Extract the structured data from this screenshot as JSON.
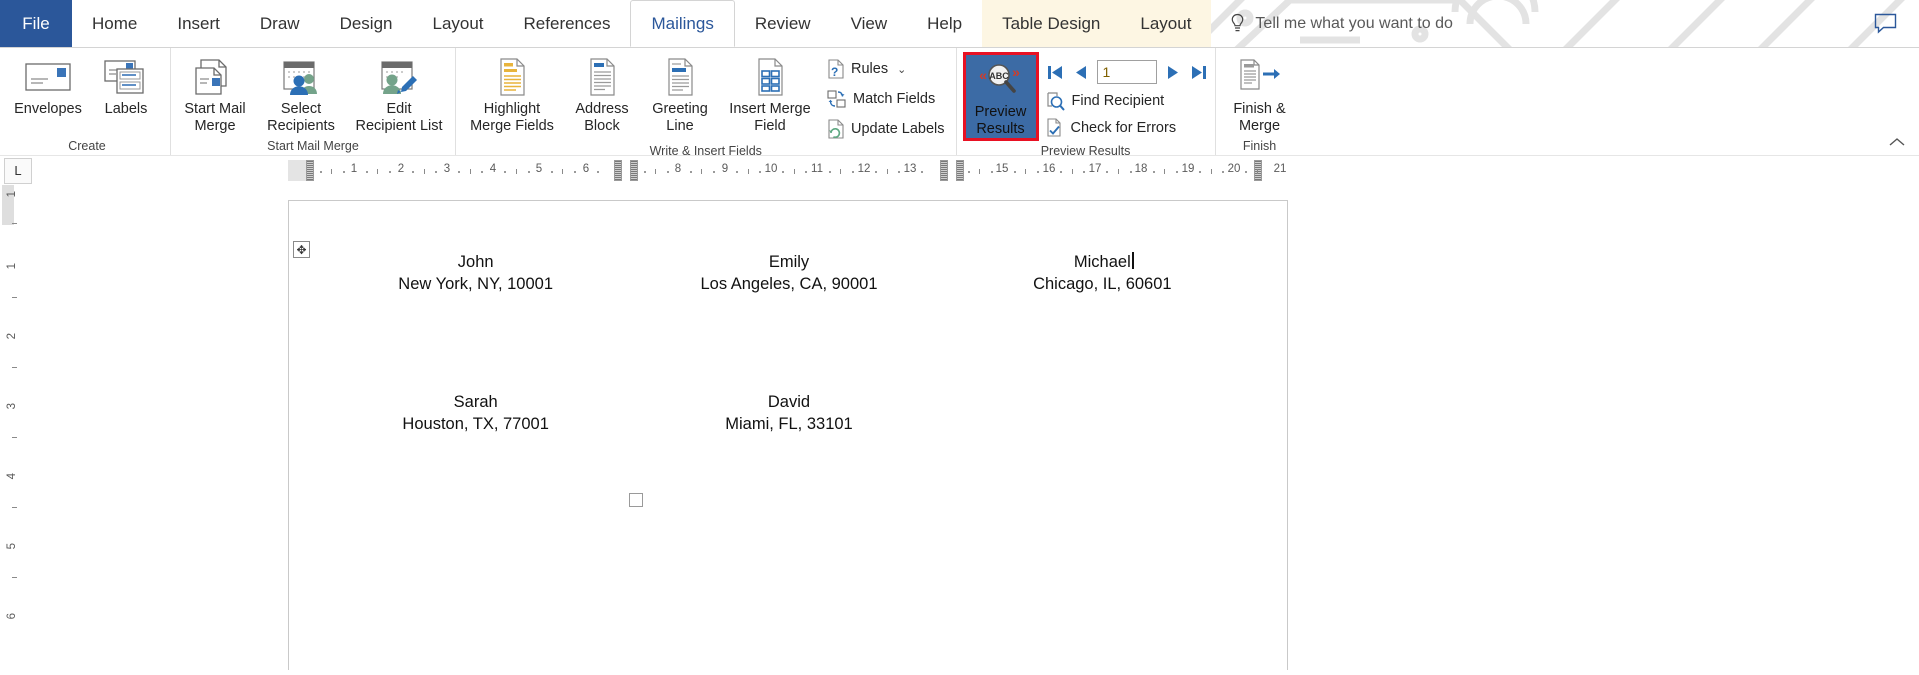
{
  "app": {
    "tabs": [
      {
        "label": "File",
        "state": "file"
      },
      {
        "label": "Home",
        "state": "normal"
      },
      {
        "label": "Insert",
        "state": "normal"
      },
      {
        "label": "Draw",
        "state": "normal"
      },
      {
        "label": "Design",
        "state": "normal"
      },
      {
        "label": "Layout",
        "state": "normal"
      },
      {
        "label": "References",
        "state": "normal"
      },
      {
        "label": "Mailings",
        "state": "active"
      },
      {
        "label": "Review",
        "state": "normal"
      },
      {
        "label": "View",
        "state": "normal"
      },
      {
        "label": "Help",
        "state": "normal"
      },
      {
        "label": "Table Design",
        "state": "contextual"
      },
      {
        "label": "Layout",
        "state": "contextual"
      }
    ],
    "tell_me": {
      "icon": "lightbulb-icon",
      "placeholder": "Tell me what you want to do"
    },
    "comment_icon": "comment-icon",
    "collapse_ribbon_icon": "chevron-up-icon",
    "colors": {
      "file_tab_blue": "#2b579a",
      "active_tab_text": "#2b579a",
      "contextual_tab_bg": "#fdf6e3",
      "highlight_red": "#e81123",
      "selected_button_bg": "#3c6ba5",
      "record_number_text": "#7f6000"
    }
  },
  "ribbon": {
    "groups": [
      {
        "label": "Create",
        "buttons": [
          {
            "label": "Envelopes",
            "icon": "envelope-icon",
            "dropdown": false
          },
          {
            "label": "Labels",
            "icon": "labels-icon",
            "dropdown": false
          }
        ]
      },
      {
        "label": "Start Mail Merge",
        "buttons": [
          {
            "label": "Start Mail\nMerge",
            "icon": "start-mail-merge-icon",
            "dropdown": true
          },
          {
            "label": "Select\nRecipients",
            "icon": "select-recipients-icon",
            "dropdown": true
          },
          {
            "label": "Edit\nRecipient List",
            "icon": "edit-recipient-list-icon",
            "dropdown": false
          }
        ]
      },
      {
        "label": "Write & Insert Fields",
        "buttons": [
          {
            "label": "Highlight\nMerge Fields",
            "icon": "highlight-merge-fields-icon",
            "dropdown": false
          },
          {
            "label": "Address\nBlock",
            "icon": "address-block-icon",
            "dropdown": false
          },
          {
            "label": "Greeting\nLine",
            "icon": "greeting-line-icon",
            "dropdown": false
          },
          {
            "label": "Insert Merge\nField",
            "icon": "insert-merge-field-icon",
            "dropdown": true
          }
        ],
        "small_buttons": [
          {
            "label": "Rules",
            "icon": "rules-icon",
            "dropdown": true
          },
          {
            "label": "Match Fields",
            "icon": "match-fields-icon",
            "dropdown": false
          },
          {
            "label": "Update Labels",
            "icon": "update-labels-icon",
            "dropdown": false
          }
        ]
      },
      {
        "label": "Preview Results",
        "buttons": [
          {
            "label": "Preview\nResults",
            "icon": "preview-results-icon",
            "dropdown": false,
            "selected": true,
            "highlighted": true
          }
        ],
        "navigation": {
          "first_icon": "first-record-icon",
          "prev_icon": "previous-record-icon",
          "record_number": "1",
          "next_icon": "next-record-icon",
          "last_icon": "last-record-icon"
        },
        "small_buttons": [
          {
            "label": "Find Recipient",
            "icon": "find-recipient-icon",
            "dropdown": false
          },
          {
            "label": "Check for Errors",
            "icon": "check-for-errors-icon",
            "dropdown": false
          }
        ]
      },
      {
        "label": "Finish",
        "buttons": [
          {
            "label": "Finish &\nMerge",
            "icon": "finish-merge-icon",
            "dropdown": true
          }
        ]
      }
    ]
  },
  "ruler": {
    "tab_stop_marker": "L",
    "horizontal_numbers": [
      "1",
      "2",
      "3",
      "4",
      "5",
      "6",
      "8",
      "9",
      "10",
      "11",
      "12",
      "13",
      "15",
      "16",
      "17",
      "18",
      "19",
      "20",
      "21"
    ],
    "vertical_numbers": [
      "1",
      "1",
      "2",
      "3",
      "4",
      "5",
      "6"
    ]
  },
  "document": {
    "table_move_handle_icon": "table-move-handle-icon",
    "end_of_table_mark_icon": "table-end-mark-icon",
    "labels": [
      {
        "name": "John",
        "address": "New York, NY, 10001",
        "caret": false
      },
      {
        "name": "Emily",
        "address": "Los Angeles, CA, 90001",
        "caret": false
      },
      {
        "name": "Michael",
        "address": "Chicago, IL, 60601",
        "caret": true
      },
      {
        "name": "Sarah",
        "address": "Houston, TX, 77001",
        "caret": false
      },
      {
        "name": "David",
        "address": "Miami, FL, 33101",
        "caret": false
      },
      {
        "name": "",
        "address": "",
        "caret": false
      }
    ]
  }
}
